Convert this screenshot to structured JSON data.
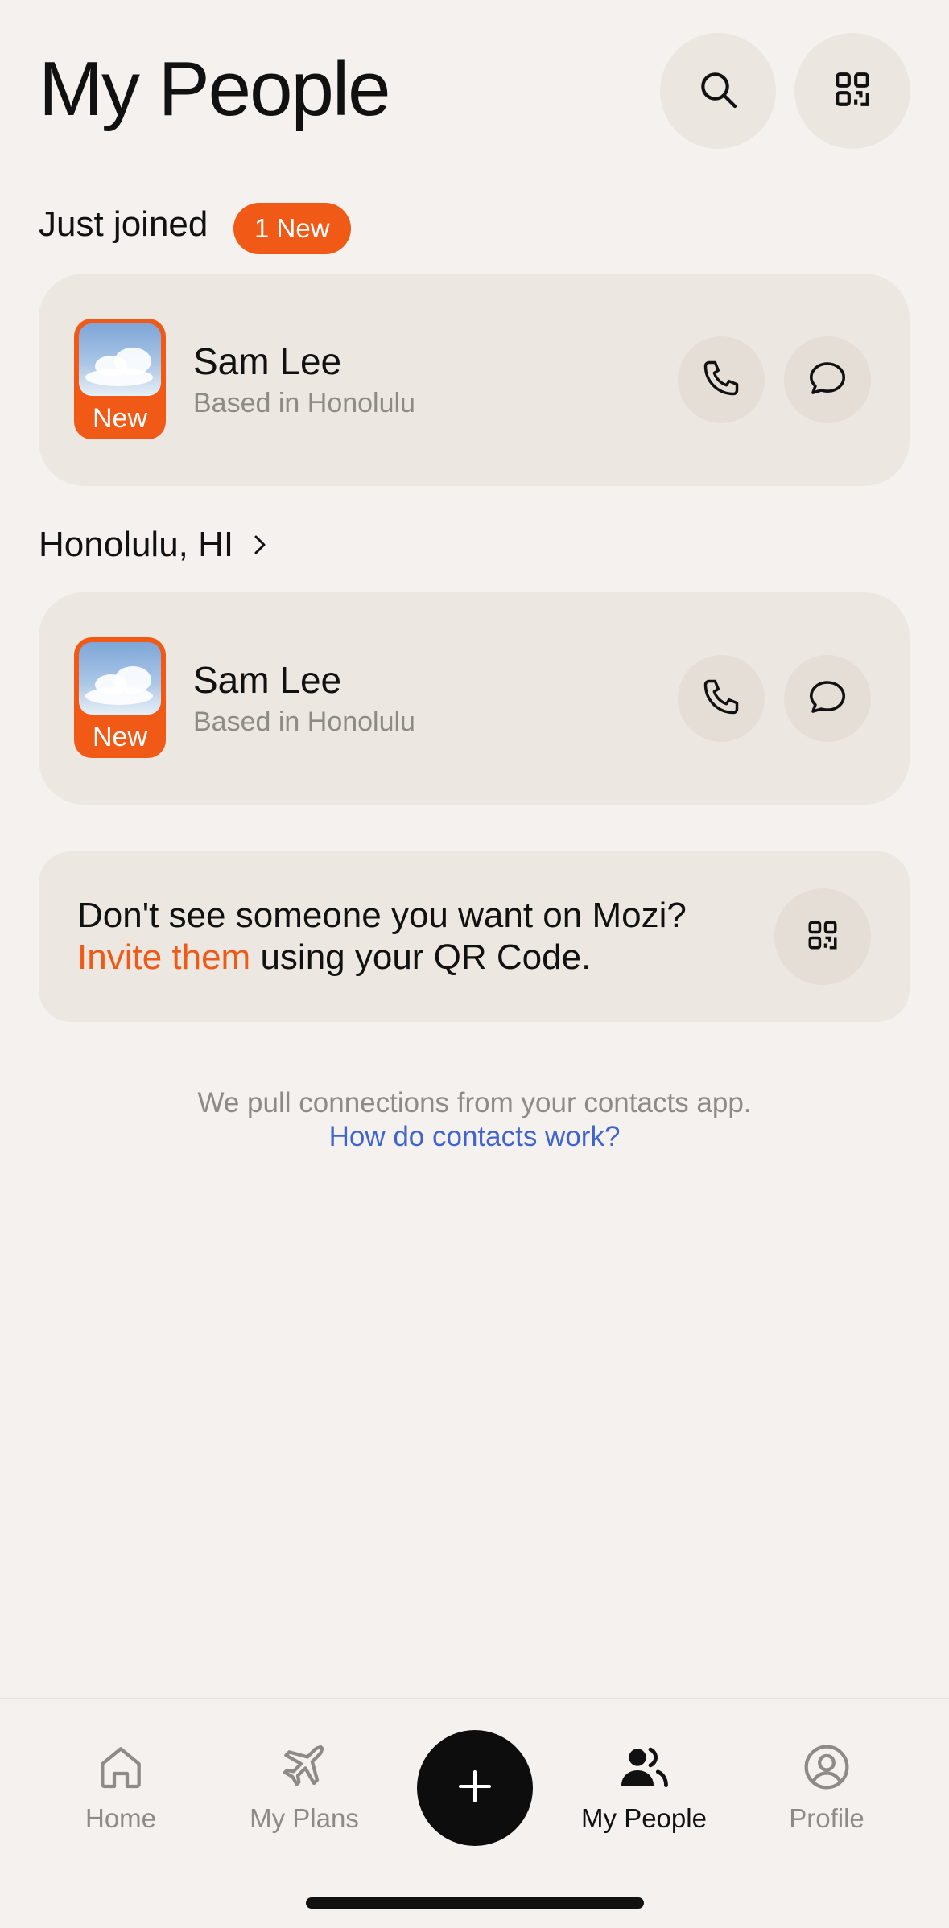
{
  "header": {
    "title": "My People",
    "search_icon": "search-icon",
    "qr_icon": "qr-code-icon"
  },
  "just_joined": {
    "title": "Just joined",
    "badge": "1 New",
    "person": {
      "name": "Sam Lee",
      "subtitle": "Based in Honolulu",
      "avatar_label": "New"
    }
  },
  "honolulu": {
    "title": "Honolulu, HI",
    "person": {
      "name": "Sam Lee",
      "subtitle": "Based in Honolulu",
      "avatar_label": "New"
    }
  },
  "invite": {
    "line1": "Don't see someone you want on Mozi?",
    "link": "Invite them",
    "rest": " using your QR Code."
  },
  "footnote": {
    "text": "We pull connections from your contacts app.",
    "link": "How do contacts work?"
  },
  "tabbar": {
    "home": "Home",
    "plans": "My Plans",
    "people": "My People",
    "profile": "Profile"
  },
  "colors": {
    "accent": "#f05a16",
    "link_blue": "#3f64cf",
    "background": "#f4f1ee",
    "card": "#ece8e1"
  }
}
